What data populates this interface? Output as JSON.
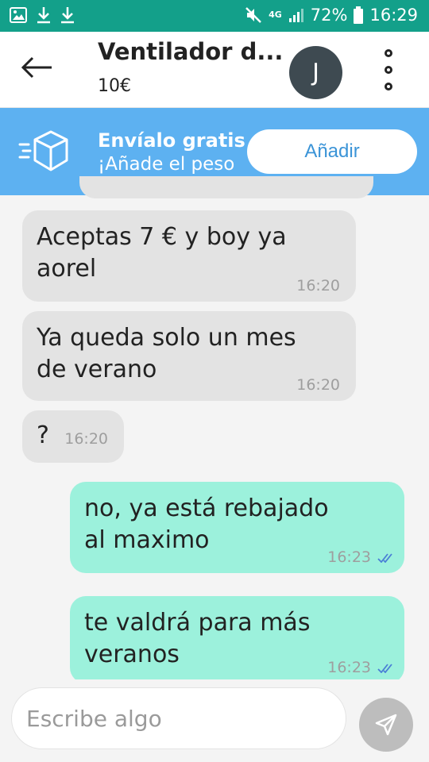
{
  "status_bar": {
    "network": "4G",
    "battery_percent": "72%",
    "time": "16:29",
    "icons": [
      "gallery-icon",
      "download-icon",
      "download-icon",
      "mute-icon",
      "signal-icon",
      "battery-icon"
    ]
  },
  "header": {
    "title": "Ventilador d...",
    "price": "10€",
    "avatar_letter": "J",
    "avatar_color": "#3e4a51"
  },
  "promo": {
    "title": "Envíalo gratis",
    "subtitle": "¡Añade el peso",
    "button_label": "Añadir",
    "bg_color": "#5db1f1"
  },
  "messages": [
    {
      "direction": "in",
      "text_lines": [
        "Aceptas  7 € y boy ya",
        "aorel"
      ],
      "time": "16:20"
    },
    {
      "direction": "in",
      "text_lines": [
        "Ya queda solo un mes",
        "de verano"
      ],
      "time": "16:20"
    },
    {
      "direction": "in",
      "text_lines": [
        "?"
      ],
      "time": "16:20"
    },
    {
      "direction": "out",
      "text_lines": [
        "no, ya está rebajado",
        "al maximo"
      ],
      "time": "16:23",
      "read": true
    },
    {
      "direction": "out",
      "text_lines": [
        "te valdrá para más",
        "veranos"
      ],
      "time": "16:23",
      "read": true
    }
  ],
  "composer": {
    "placeholder": "Escribe algo"
  },
  "colors": {
    "status_bar": "#13a08a",
    "incoming_bubble": "#e3e3e3",
    "outgoing_bubble": "#9cf1dc"
  }
}
